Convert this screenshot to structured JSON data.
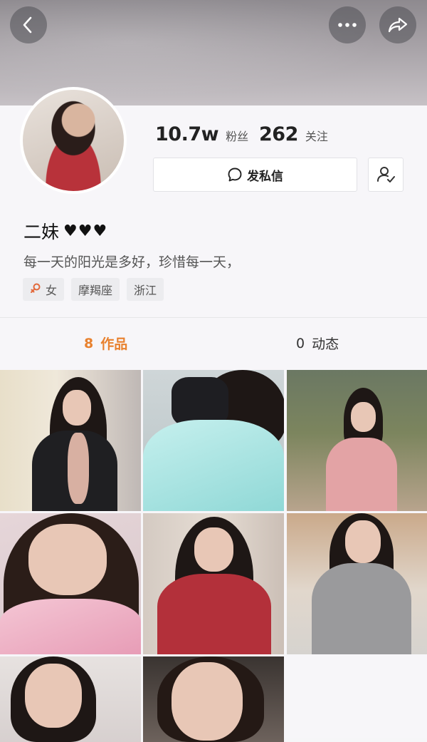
{
  "header": {
    "back_icon": "chevron-left-icon",
    "more_icon": "more-dots-icon",
    "share_icon": "share-arrow-icon"
  },
  "profile": {
    "stats": {
      "fans_count": "10.7w",
      "fans_label": "粉丝",
      "following_count": "262",
      "following_label": "关注"
    },
    "message_button": "发私信",
    "name": "二妹",
    "name_suffix": "♥♥♥",
    "bio": "每一天的阳光是多好，珍惜每一天，",
    "tags": {
      "gender": "女",
      "zodiac": "摩羯座",
      "location": "浙江"
    }
  },
  "tabs": {
    "works_count": "8",
    "works_label": "作品",
    "dynamics_count": "0",
    "dynamics_label": "动态"
  },
  "colors": {
    "accent": "#e8812e",
    "tag_bg": "#ececef",
    "gender_icon": "#e2683a"
  },
  "works": [
    {
      "id": "work-1"
    },
    {
      "id": "work-2"
    },
    {
      "id": "work-3"
    },
    {
      "id": "work-4"
    },
    {
      "id": "work-5"
    },
    {
      "id": "work-6"
    },
    {
      "id": "work-7"
    },
    {
      "id": "work-8"
    }
  ]
}
